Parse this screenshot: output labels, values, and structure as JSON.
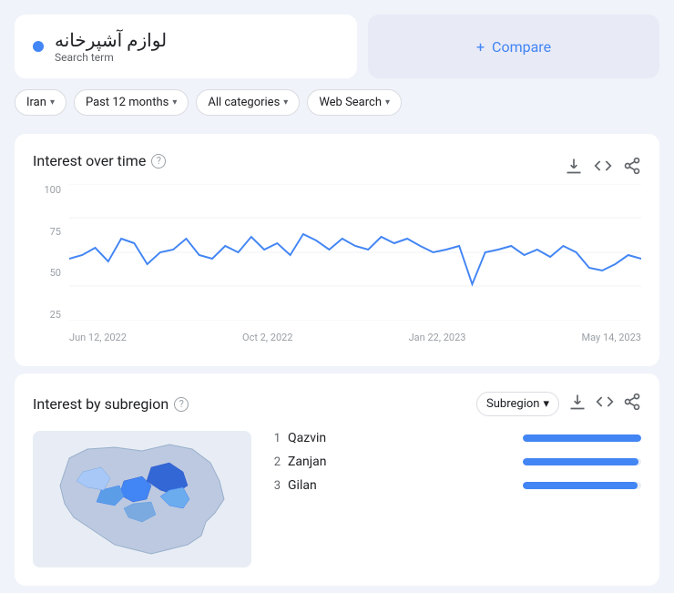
{
  "searchTerm": {
    "text": "لوازم آشپرخانه",
    "label": "Search term",
    "dotColor": "#4285f4"
  },
  "compare": {
    "label": "Compare",
    "plusIcon": "+"
  },
  "filters": [
    {
      "id": "region",
      "label": "Iran"
    },
    {
      "id": "time",
      "label": "Past 12 months"
    },
    {
      "id": "category",
      "label": "All categories"
    },
    {
      "id": "search",
      "label": "Web Search"
    }
  ],
  "interestOverTime": {
    "title": "Interest over time",
    "yAxis": [
      "100",
      "75",
      "50",
      "25"
    ],
    "xAxis": [
      "Jun 12, 2022",
      "Oct 2, 2022",
      "Jan 22, 2023",
      "May 14, 2023"
    ],
    "downloadIcon": "⬇",
    "embedIcon": "<>",
    "shareIcon": "🔗"
  },
  "interestBySubregion": {
    "title": "Interest by subregion",
    "dropdownLabel": "Subregion",
    "regions": [
      {
        "rank": 1,
        "name": "Qazvin",
        "value": 100
      },
      {
        "rank": 2,
        "name": "Zanjan",
        "value": 98
      },
      {
        "rank": 3,
        "name": "Gilan",
        "value": 97
      }
    ]
  }
}
